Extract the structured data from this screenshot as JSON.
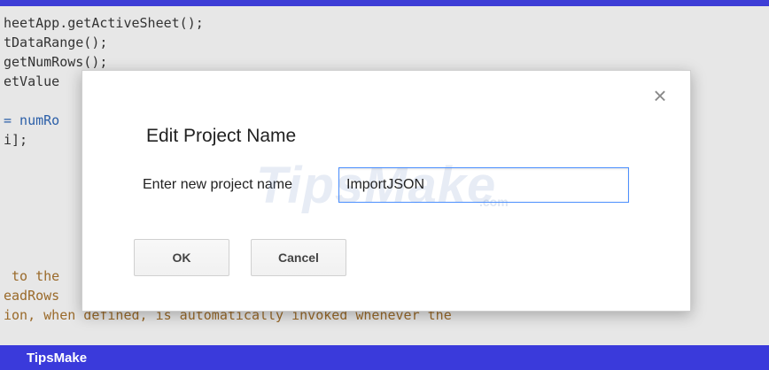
{
  "code": {
    "lines": [
      "heetApp.getActiveSheet();",
      "tDataRange();",
      "getNumRows();",
      "etValue",
      "",
      "= numRo",
      "i];",
      "",
      "",
      "",
      "",
      "",
      " to the",
      "eadRows",
      "ion, when defined, is automatically invoked whenever the"
    ]
  },
  "dialog": {
    "title": "Edit Project Name",
    "close_icon": "close-icon",
    "close_glyph": "×",
    "field_label": "Enter new project name",
    "input_value": "ImportJSON",
    "ok_label": "OK",
    "cancel_label": "Cancel"
  },
  "watermark": {
    "text": "TipsMake",
    "sub": ".com"
  },
  "footer": {
    "brand": "TipsMake"
  },
  "colors": {
    "accent_bar": "#3a3adb",
    "input_focus": "#4d90fe"
  }
}
